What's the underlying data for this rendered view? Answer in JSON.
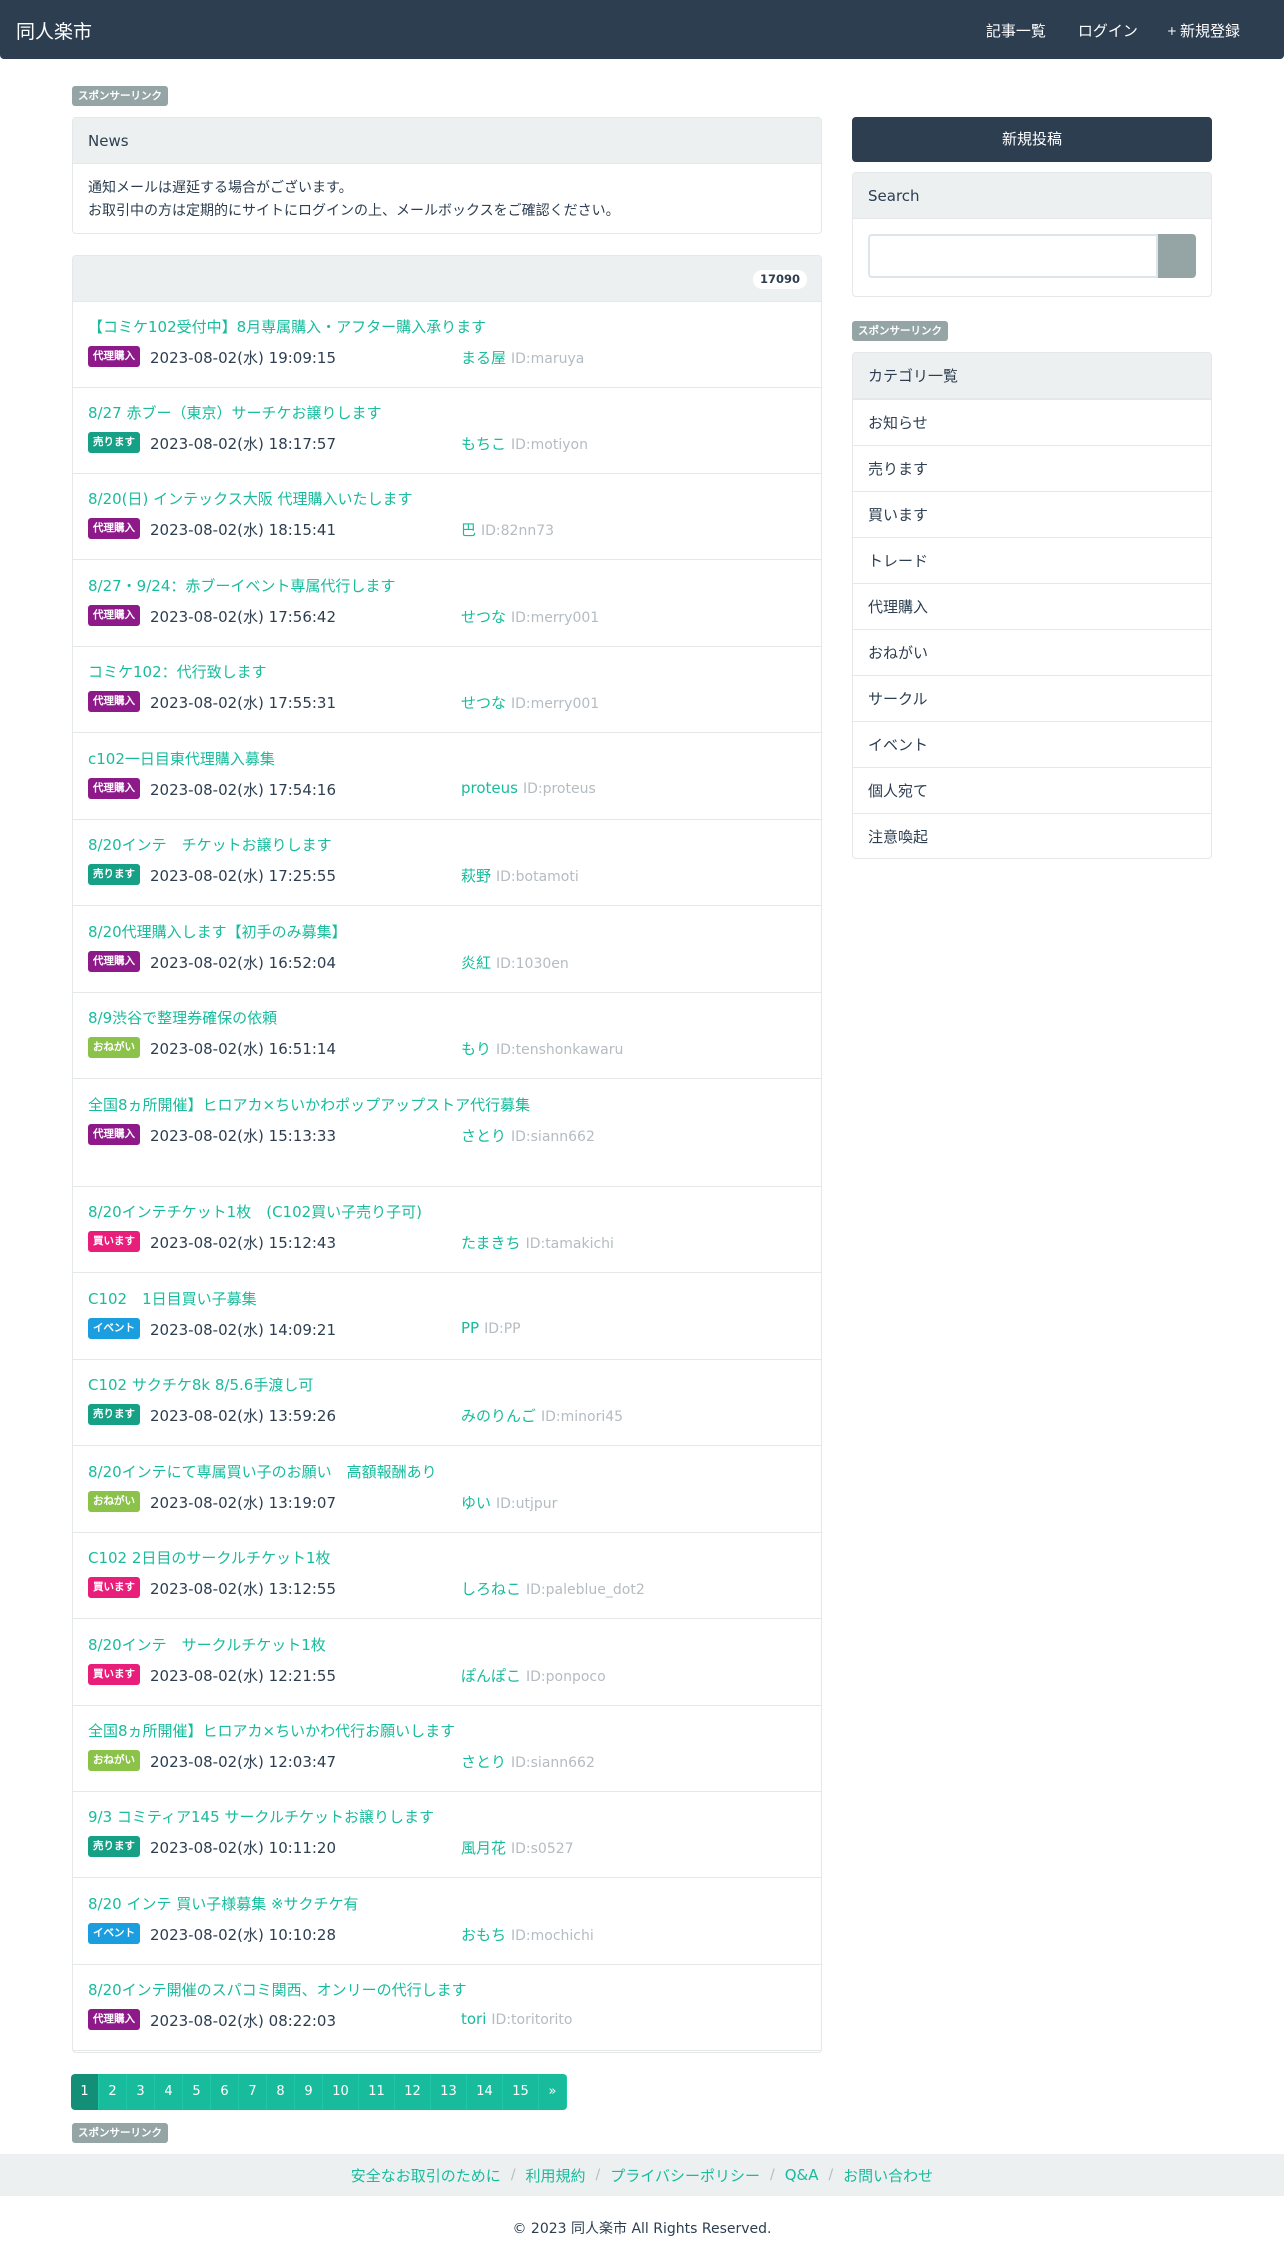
{
  "header": {
    "brand": "同人楽市",
    "nav": [
      {
        "icon": "",
        "label": "記事一覧"
      },
      {
        "icon": "",
        "label": "ログイン"
      },
      {
        "icon": "+",
        "label": "新規登録"
      }
    ]
  },
  "sponsor_label": "スポンサーリンク",
  "news": {
    "heading": "News",
    "lines": [
      "通知メールは遅延する場合がございます。",
      "お取引中の方は定期的にサイトにログインの上、メールボックスをご確認ください。"
    ]
  },
  "post_list": {
    "count": "17090",
    "posts": [
      {
        "title": "【コミケ102受付中】8月専属購入・アフター購入承ります",
        "category": "代理購入",
        "date": "2023-08-02(水) 19:09:15",
        "user": "まる屋",
        "user_id": "ID:maruya"
      },
      {
        "title": "8/27 赤ブー（東京）サーチケお譲りします",
        "category": "売ります",
        "date": "2023-08-02(水) 18:17:57",
        "user": "もちこ",
        "user_id": "ID:motiyon"
      },
      {
        "title": "8/20(日) インテックス大阪 代理購入いたします",
        "category": "代理購入",
        "date": "2023-08-02(水) 18:15:41",
        "user": "巴",
        "user_id": "ID:82nn73"
      },
      {
        "title": "8/27・9/24：赤ブーイベント専属代行します",
        "category": "代理購入",
        "date": "2023-08-02(水) 17:56:42",
        "user": "せつな",
        "user_id": "ID:merry001"
      },
      {
        "title": "コミケ102：代行致します",
        "category": "代理購入",
        "date": "2023-08-02(水) 17:55:31",
        "user": "せつな",
        "user_id": "ID:merry001"
      },
      {
        "title": "c102一日目東代理購入募集",
        "category": "代理購入",
        "date": "2023-08-02(水) 17:54:16",
        "user": "proteus",
        "user_id": "ID:proteus"
      },
      {
        "title": "8/20インテ　チケットお譲りします",
        "category": "売ります",
        "date": "2023-08-02(水) 17:25:55",
        "user": "萩野",
        "user_id": "ID:botamoti"
      },
      {
        "title": "8/20代理購入します【初手のみ募集】",
        "category": "代理購入",
        "date": "2023-08-02(水) 16:52:04",
        "user": "炎紅",
        "user_id": "ID:1030en"
      },
      {
        "title": "8/9渋谷で整理券確保の依頼",
        "category": "おねがい",
        "date": "2023-08-02(水) 16:51:14",
        "user": "もり",
        "user_id": "ID:tenshonkawaru"
      },
      {
        "title": "全国8ヵ所開催】ヒロアカ×ちいかわポップアップストア代行募集",
        "category": "代理購入",
        "date": "2023-08-02(水) 15:13:33",
        "user": "さとり",
        "user_id": "ID:siann662"
      },
      {
        "title": "8/20インテチケット1枚　(C102買い子売り子可)",
        "category": "買います",
        "date": "2023-08-02(水) 15:12:43",
        "user": "たまきち",
        "user_id": "ID:tamakichi"
      },
      {
        "title": "C102　1日目買い子募集",
        "category": "イベント",
        "date": "2023-08-02(水) 14:09:21",
        "user": "PP",
        "user_id": "ID:PP"
      },
      {
        "title": "C102 サクチケ8k 8/5.6手渡し可",
        "category": "売ります",
        "date": "2023-08-02(水) 13:59:26",
        "user": "みのりんご",
        "user_id": "ID:minori45"
      },
      {
        "title": "8/20インテにて専属買い子のお願い　高額報酬あり",
        "category": "おねがい",
        "date": "2023-08-02(水) 13:19:07",
        "user": "ゆい",
        "user_id": "ID:utjpur"
      },
      {
        "title": "C102 2日目のサークルチケット1枚",
        "category": "買います",
        "date": "2023-08-02(水) 13:12:55",
        "user": "しろねこ",
        "user_id": "ID:paleblue_dot2"
      },
      {
        "title": "8/20インテ　サークルチケット1枚",
        "category": "買います",
        "date": "2023-08-02(水) 12:21:55",
        "user": "ぽんぽこ",
        "user_id": "ID:ponpoco"
      },
      {
        "title": "全国8ヵ所開催】ヒロアカ×ちいかわ代行お願いします",
        "category": "おねがい",
        "date": "2023-08-02(水) 12:03:47",
        "user": "さとり",
        "user_id": "ID:siann662"
      },
      {
        "title": "9/3 コミティア145 サークルチケットお譲りします",
        "category": "売ります",
        "date": "2023-08-02(水) 10:11:20",
        "user": "風月花",
        "user_id": "ID:s0527"
      },
      {
        "title": "8/20 インテ 買い子様募集 ※サクチケ有",
        "category": "イベント",
        "date": "2023-08-02(水) 10:10:28",
        "user": "おもち",
        "user_id": "ID:mochichi"
      },
      {
        "title": "8/20インテ開催のスパコミ関西、オンリーの代行します",
        "category": "代理購入",
        "date": "2023-08-02(水) 08:22:03",
        "user": "tori",
        "user_id": "ID:toritorito"
      }
    ]
  },
  "category_colors": {
    "代理購入": "#8e1a8a",
    "売ります": "#16a085",
    "買います": "#e91e7a",
    "おねがい": "#8bc34a",
    "イベント": "#1a9ee0"
  },
  "pagination": {
    "pages": [
      "1",
      "2",
      "3",
      "4",
      "5",
      "6",
      "7",
      "8",
      "9",
      "10",
      "11",
      "12",
      "13",
      "14",
      "15",
      "»"
    ],
    "active": "1"
  },
  "sidebar": {
    "post_button": "新規投稿",
    "search_heading": "Search",
    "search_button_icon": "",
    "category_heading": "カテゴリ一覧",
    "categories": [
      "お知らせ",
      "売ります",
      "買います",
      "トレード",
      "代理購入",
      "おねがい",
      "サークル",
      "イベント",
      "個人宛て",
      "注意喚起"
    ]
  },
  "footer": {
    "links": [
      "安全なお取引のために",
      "利用規約",
      "プライバシーポリシー",
      "Q&A",
      "お問い合わせ"
    ],
    "copyright": "© 2023 同人楽市 All Rights Reserved."
  }
}
